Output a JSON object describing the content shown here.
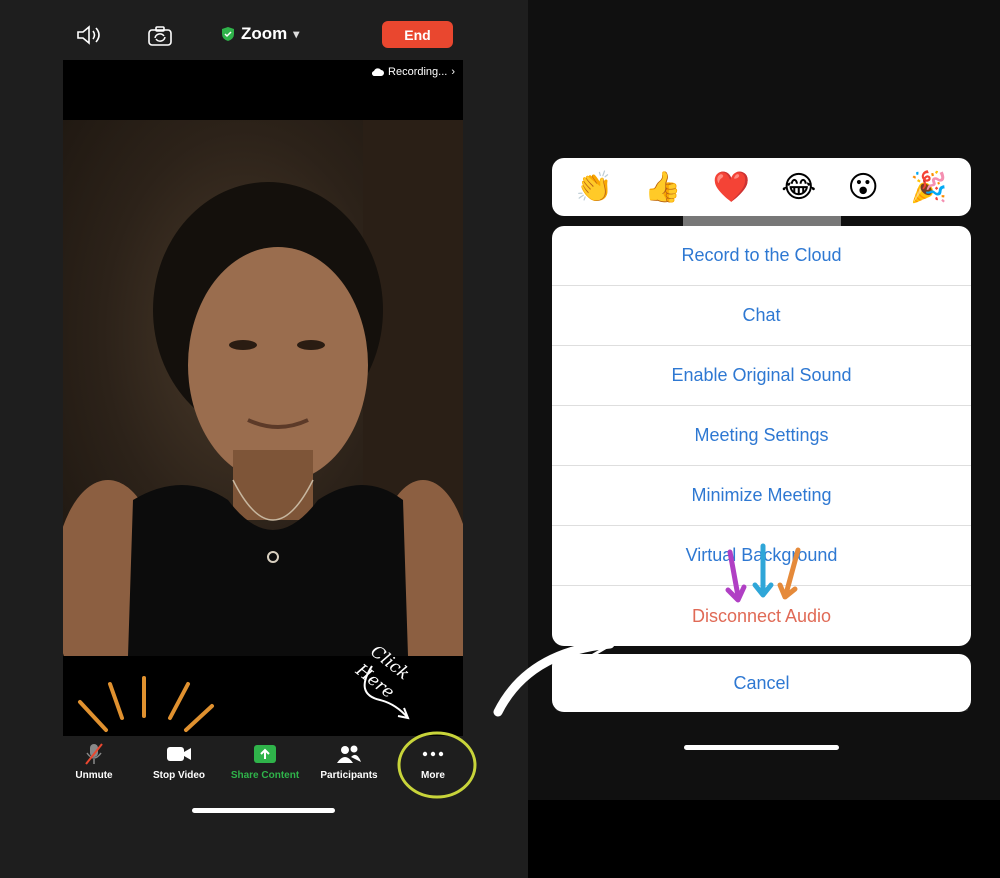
{
  "left": {
    "meeting_title": "Zoom",
    "end_label": "End",
    "recording_label": "Recording...",
    "toolbar": [
      {
        "id": "unmute",
        "label": "Unmute"
      },
      {
        "id": "stop-video",
        "label": "Stop Video"
      },
      {
        "id": "share-content",
        "label": "Share Content"
      },
      {
        "id": "participants",
        "label": "Participants"
      },
      {
        "id": "more",
        "label": "More"
      }
    ],
    "annotation": "Click Here"
  },
  "right": {
    "reactions": [
      "👏",
      "👍",
      "❤️",
      "😂",
      "😮",
      "🎉"
    ],
    "menu_items": [
      "Record to the Cloud",
      "Chat",
      "Enable Original Sound",
      "Meeting Settings",
      "Minimize Meeting",
      "Virtual Background",
      "Disconnect Audio"
    ],
    "cancel_label": "Cancel"
  },
  "colors": {
    "end_button": "#e9472f",
    "share_green": "#2fb34a",
    "menu_blue": "#2e78d2",
    "danger_red": "#e06a56",
    "annotation_yellow": "#c8d43a"
  }
}
